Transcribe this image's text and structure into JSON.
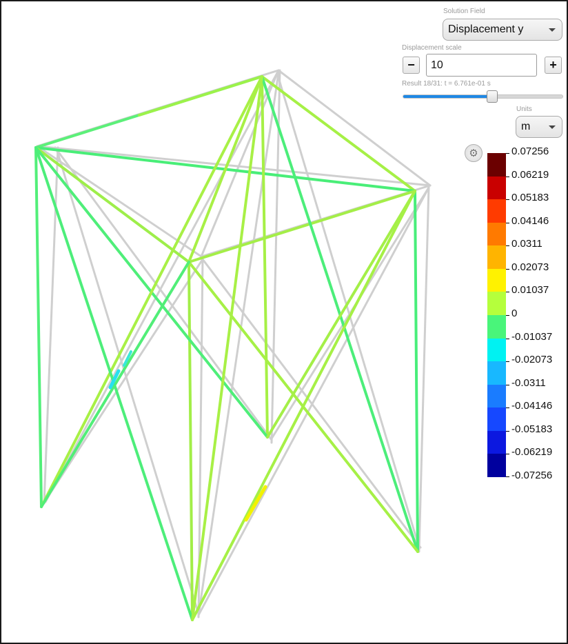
{
  "solution_field": {
    "label": "Solution Field",
    "selected": "Displacement y"
  },
  "displacement_scale": {
    "label": "Displacement scale",
    "minus": "−",
    "value": "10",
    "plus": "+"
  },
  "result": {
    "text": "Result 18/31: t = 6.761e-01 s",
    "slider_fraction": 0.56
  },
  "units": {
    "label": "Units",
    "selected": "m"
  },
  "settings_icon": "gear-icon",
  "colorbar": {
    "labels": [
      "0.07256",
      "0.06219",
      "0.05183",
      "0.04146",
      "0.0311",
      "0.02073",
      "0.01037",
      "0",
      "-0.01037",
      "-0.02073",
      "-0.0311",
      "-0.04146",
      "-0.05183",
      "-0.06219",
      "-0.07256"
    ],
    "colors": [
      "#6b0000",
      "#c90000",
      "#ff3b00",
      "#ff7a00",
      "#ffb400",
      "#fff200",
      "#b5ff3c",
      "#49f57a",
      "#00f2f2",
      "#18b8ff",
      "#1a7cff",
      "#1648ff",
      "#0c18e0",
      "#00009e"
    ]
  }
}
